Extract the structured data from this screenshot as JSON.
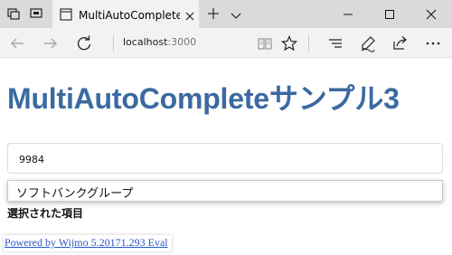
{
  "browser": {
    "tab_title": "MultiAutoCompleteサンプ",
    "url_host": "localhost",
    "url_port": ":3000"
  },
  "icons": {
    "set_aside": "tabs-aside-icon",
    "tab_previews": "tab-preview-icon",
    "favicon": "page-favicon-icon",
    "close_tab": "close-icon",
    "new_tab": "plus-icon",
    "tab_list": "chevron-down-icon",
    "minimize": "minimize-icon",
    "maximize": "maximize-icon",
    "close_window": "close-icon",
    "back": "back-arrow-icon",
    "forward": "forward-arrow-icon",
    "refresh": "refresh-icon",
    "reading_view": "book-icon",
    "favorites": "star-icon",
    "hub": "hub-icon",
    "notes": "pen-icon",
    "share": "share-icon",
    "more": "more-icon"
  },
  "page": {
    "heading": "MultiAutoCompleteサンプル3",
    "input_value": "9984",
    "suggestions": [
      "ソフトバンクグループ"
    ],
    "selected_label": "選択された項目",
    "footer_link": "Powered by Wijmo 5.20171.293 Eval"
  },
  "colors": {
    "heading": "#3b6aa0",
    "link": "#2a57c7",
    "tabbar": "#dadada",
    "active_tab": "#f2f2f2"
  }
}
